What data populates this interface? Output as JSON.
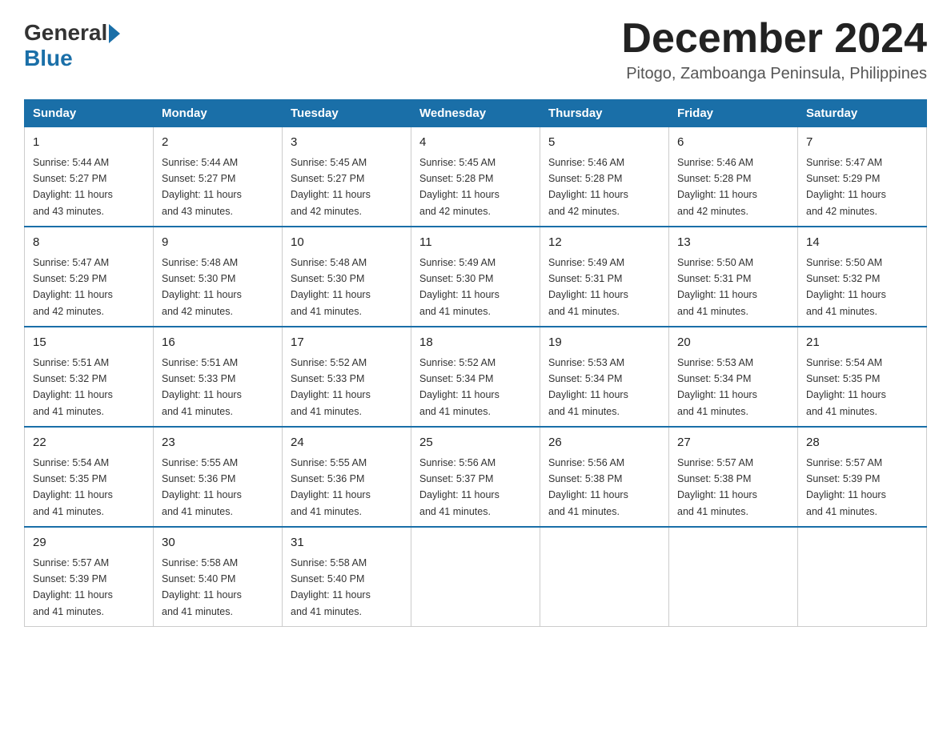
{
  "header": {
    "month_title": "December 2024",
    "subtitle": "Pitogo, Zamboanga Peninsula, Philippines",
    "logo_general": "General",
    "logo_blue": "Blue"
  },
  "days_of_week": [
    "Sunday",
    "Monday",
    "Tuesday",
    "Wednesday",
    "Thursday",
    "Friday",
    "Saturday"
  ],
  "weeks": [
    [
      {
        "day": "1",
        "sunrise": "5:44 AM",
        "sunset": "5:27 PM",
        "daylight": "11 hours and 43 minutes."
      },
      {
        "day": "2",
        "sunrise": "5:44 AM",
        "sunset": "5:27 PM",
        "daylight": "11 hours and 43 minutes."
      },
      {
        "day": "3",
        "sunrise": "5:45 AM",
        "sunset": "5:27 PM",
        "daylight": "11 hours and 42 minutes."
      },
      {
        "day": "4",
        "sunrise": "5:45 AM",
        "sunset": "5:28 PM",
        "daylight": "11 hours and 42 minutes."
      },
      {
        "day": "5",
        "sunrise": "5:46 AM",
        "sunset": "5:28 PM",
        "daylight": "11 hours and 42 minutes."
      },
      {
        "day": "6",
        "sunrise": "5:46 AM",
        "sunset": "5:28 PM",
        "daylight": "11 hours and 42 minutes."
      },
      {
        "day": "7",
        "sunrise": "5:47 AM",
        "sunset": "5:29 PM",
        "daylight": "11 hours and 42 minutes."
      }
    ],
    [
      {
        "day": "8",
        "sunrise": "5:47 AM",
        "sunset": "5:29 PM",
        "daylight": "11 hours and 42 minutes."
      },
      {
        "day": "9",
        "sunrise": "5:48 AM",
        "sunset": "5:30 PM",
        "daylight": "11 hours and 42 minutes."
      },
      {
        "day": "10",
        "sunrise": "5:48 AM",
        "sunset": "5:30 PM",
        "daylight": "11 hours and 41 minutes."
      },
      {
        "day": "11",
        "sunrise": "5:49 AM",
        "sunset": "5:30 PM",
        "daylight": "11 hours and 41 minutes."
      },
      {
        "day": "12",
        "sunrise": "5:49 AM",
        "sunset": "5:31 PM",
        "daylight": "11 hours and 41 minutes."
      },
      {
        "day": "13",
        "sunrise": "5:50 AM",
        "sunset": "5:31 PM",
        "daylight": "11 hours and 41 minutes."
      },
      {
        "day": "14",
        "sunrise": "5:50 AM",
        "sunset": "5:32 PM",
        "daylight": "11 hours and 41 minutes."
      }
    ],
    [
      {
        "day": "15",
        "sunrise": "5:51 AM",
        "sunset": "5:32 PM",
        "daylight": "11 hours and 41 minutes."
      },
      {
        "day": "16",
        "sunrise": "5:51 AM",
        "sunset": "5:33 PM",
        "daylight": "11 hours and 41 minutes."
      },
      {
        "day": "17",
        "sunrise": "5:52 AM",
        "sunset": "5:33 PM",
        "daylight": "11 hours and 41 minutes."
      },
      {
        "day": "18",
        "sunrise": "5:52 AM",
        "sunset": "5:34 PM",
        "daylight": "11 hours and 41 minutes."
      },
      {
        "day": "19",
        "sunrise": "5:53 AM",
        "sunset": "5:34 PM",
        "daylight": "11 hours and 41 minutes."
      },
      {
        "day": "20",
        "sunrise": "5:53 AM",
        "sunset": "5:34 PM",
        "daylight": "11 hours and 41 minutes."
      },
      {
        "day": "21",
        "sunrise": "5:54 AM",
        "sunset": "5:35 PM",
        "daylight": "11 hours and 41 minutes."
      }
    ],
    [
      {
        "day": "22",
        "sunrise": "5:54 AM",
        "sunset": "5:35 PM",
        "daylight": "11 hours and 41 minutes."
      },
      {
        "day": "23",
        "sunrise": "5:55 AM",
        "sunset": "5:36 PM",
        "daylight": "11 hours and 41 minutes."
      },
      {
        "day": "24",
        "sunrise": "5:55 AM",
        "sunset": "5:36 PM",
        "daylight": "11 hours and 41 minutes."
      },
      {
        "day": "25",
        "sunrise": "5:56 AM",
        "sunset": "5:37 PM",
        "daylight": "11 hours and 41 minutes."
      },
      {
        "day": "26",
        "sunrise": "5:56 AM",
        "sunset": "5:38 PM",
        "daylight": "11 hours and 41 minutes."
      },
      {
        "day": "27",
        "sunrise": "5:57 AM",
        "sunset": "5:38 PM",
        "daylight": "11 hours and 41 minutes."
      },
      {
        "day": "28",
        "sunrise": "5:57 AM",
        "sunset": "5:39 PM",
        "daylight": "11 hours and 41 minutes."
      }
    ],
    [
      {
        "day": "29",
        "sunrise": "5:57 AM",
        "sunset": "5:39 PM",
        "daylight": "11 hours and 41 minutes."
      },
      {
        "day": "30",
        "sunrise": "5:58 AM",
        "sunset": "5:40 PM",
        "daylight": "11 hours and 41 minutes."
      },
      {
        "day": "31",
        "sunrise": "5:58 AM",
        "sunset": "5:40 PM",
        "daylight": "11 hours and 41 minutes."
      },
      null,
      null,
      null,
      null
    ]
  ],
  "labels": {
    "sunrise": "Sunrise:",
    "sunset": "Sunset:",
    "daylight": "Daylight:"
  }
}
